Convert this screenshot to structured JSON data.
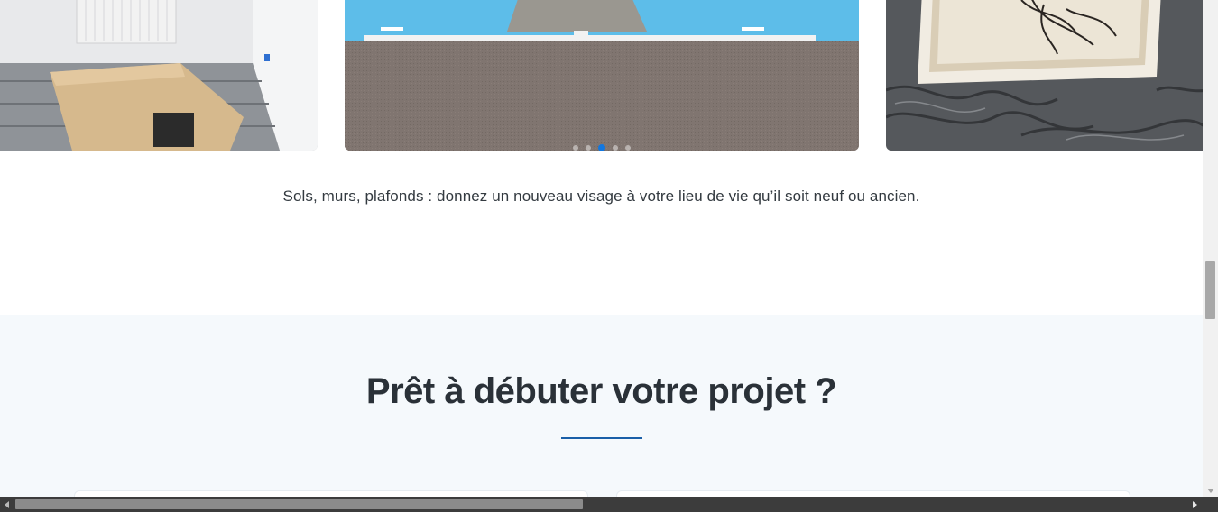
{
  "carousel": {
    "slides": [
      {
        "subject": "room with radiator and cardboard boxes on grey floor"
      },
      {
        "subject": "blue painted parking space on asphalt"
      },
      {
        "subject": "framed artwork on grey textured surface"
      }
    ],
    "active_index": 2,
    "dot_count": 5
  },
  "caption": "Sols, murs, plafonds : donnez un nouveau visage à votre lieu de vie qu’il soit neuf ou ancien.",
  "cta": {
    "title": "Prêt à débuter votre projet ?"
  },
  "colors": {
    "accent": "#1177e0",
    "rule": "#1a5fa8",
    "section_bg": "#f5f9fc",
    "text": "#2a3138"
  }
}
